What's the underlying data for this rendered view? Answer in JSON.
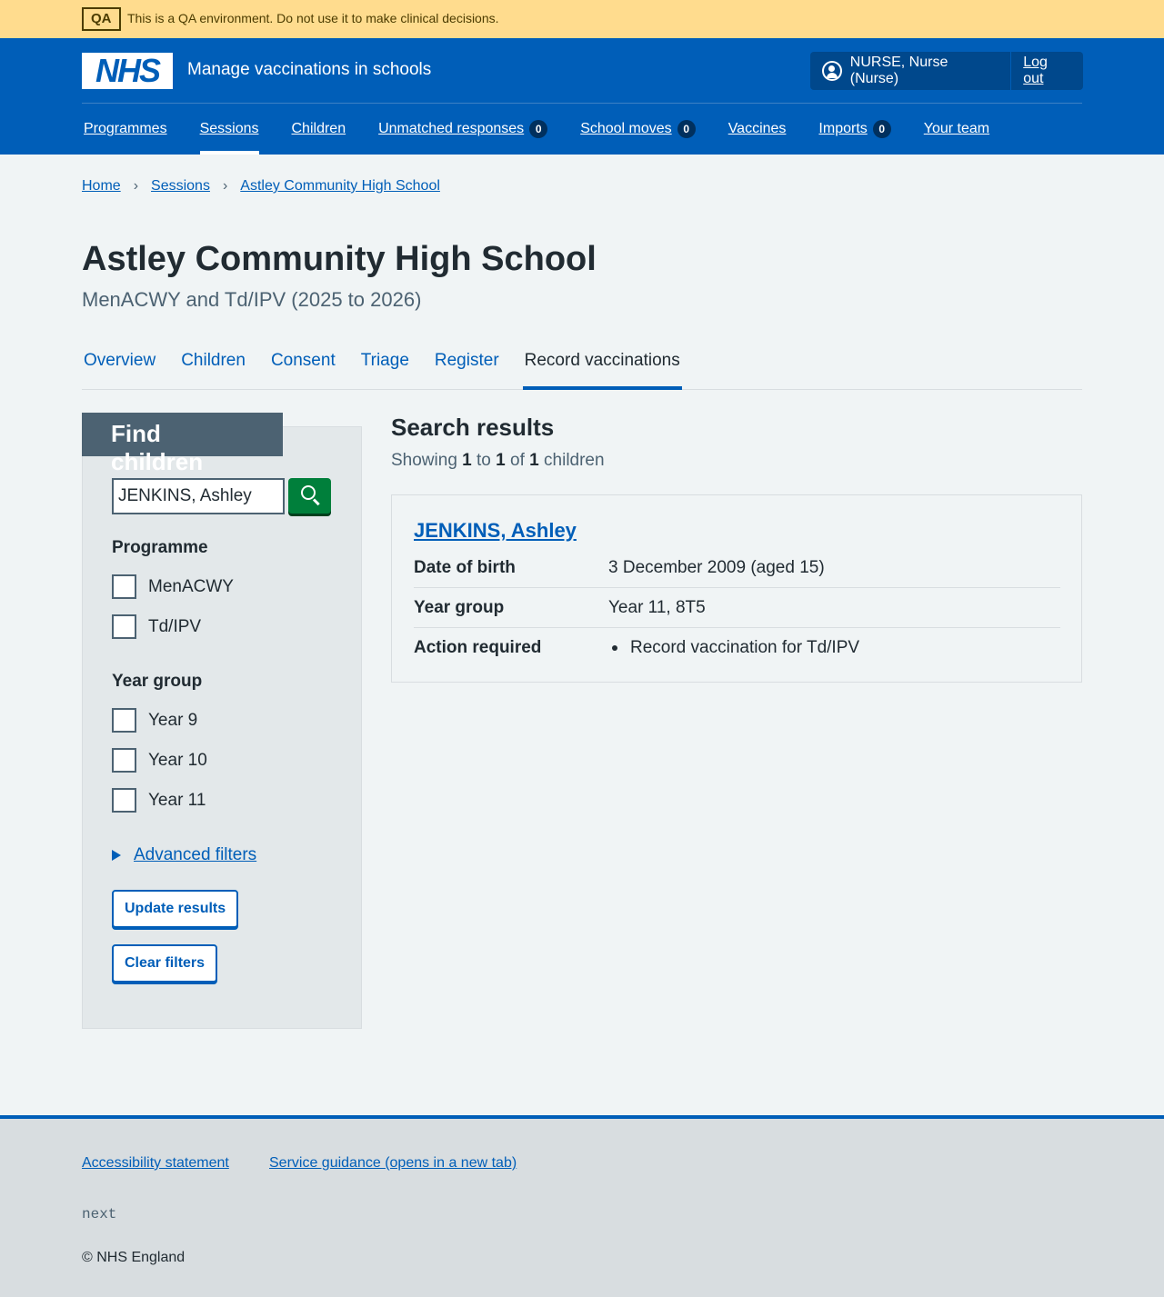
{
  "qa_banner": {
    "tag": "QA",
    "text": "This is a QA environment. Do not use it to make clinical decisions."
  },
  "header": {
    "logo": "NHS",
    "service_name": "Manage vaccinations in schools",
    "account_user": "NURSE, Nurse (Nurse)",
    "logout_label": "Log out"
  },
  "nav": {
    "items": [
      {
        "label": "Programmes"
      },
      {
        "label": "Sessions",
        "active": true
      },
      {
        "label": "Children"
      },
      {
        "label": "Unmatched responses",
        "count": "0"
      },
      {
        "label": "School moves",
        "count": "0"
      },
      {
        "label": "Vaccines"
      },
      {
        "label": "Imports",
        "count": "0"
      },
      {
        "label": "Your team"
      }
    ]
  },
  "breadcrumb": [
    "Home",
    "Sessions",
    "Astley Community High School"
  ],
  "page": {
    "title": "Astley Community High School",
    "caption": "MenACWY and Td/IPV (2025 to 2026)"
  },
  "tabs": [
    "Overview",
    "Children",
    "Consent",
    "Triage",
    "Register",
    "Record vaccinations"
  ],
  "active_tab": "Record vaccinations",
  "filters": {
    "heading": "Find children",
    "search_value": "JENKINS, Ashley",
    "programme_legend": "Programme",
    "programmes": [
      "MenACWY",
      "Td/IPV"
    ],
    "year_group_legend": "Year group",
    "year_groups": [
      "Year 9",
      "Year 10",
      "Year 11"
    ],
    "advanced_label": "Advanced filters",
    "update_label": "Update results",
    "clear_label": "Clear filters"
  },
  "results": {
    "title": "Search results",
    "summary_prefix": "Showing",
    "from": "1",
    "to_word": "to",
    "to": "1",
    "of_word": "of",
    "total": "1",
    "suffix": "children",
    "child": {
      "name": "JENKINS, Ashley",
      "dob_key": "Date of birth",
      "dob_value": "3 December 2009 (aged 15)",
      "year_key": "Year group",
      "year_value": "Year 11, 8T5",
      "action_key": "Action required",
      "action_value": "Record vaccination for Td/IPV"
    }
  },
  "footer": {
    "accessibility_label": "Accessibility statement",
    "guidance_label": "Service guidance (opens in a new tab)",
    "env": "next",
    "copyright": "© NHS England"
  },
  "colors": {
    "nhs_blue": "#005eb8",
    "qa_banner": "#ffdc8e",
    "search_button": "#007f3b",
    "page_background": "#f0f4f5"
  }
}
